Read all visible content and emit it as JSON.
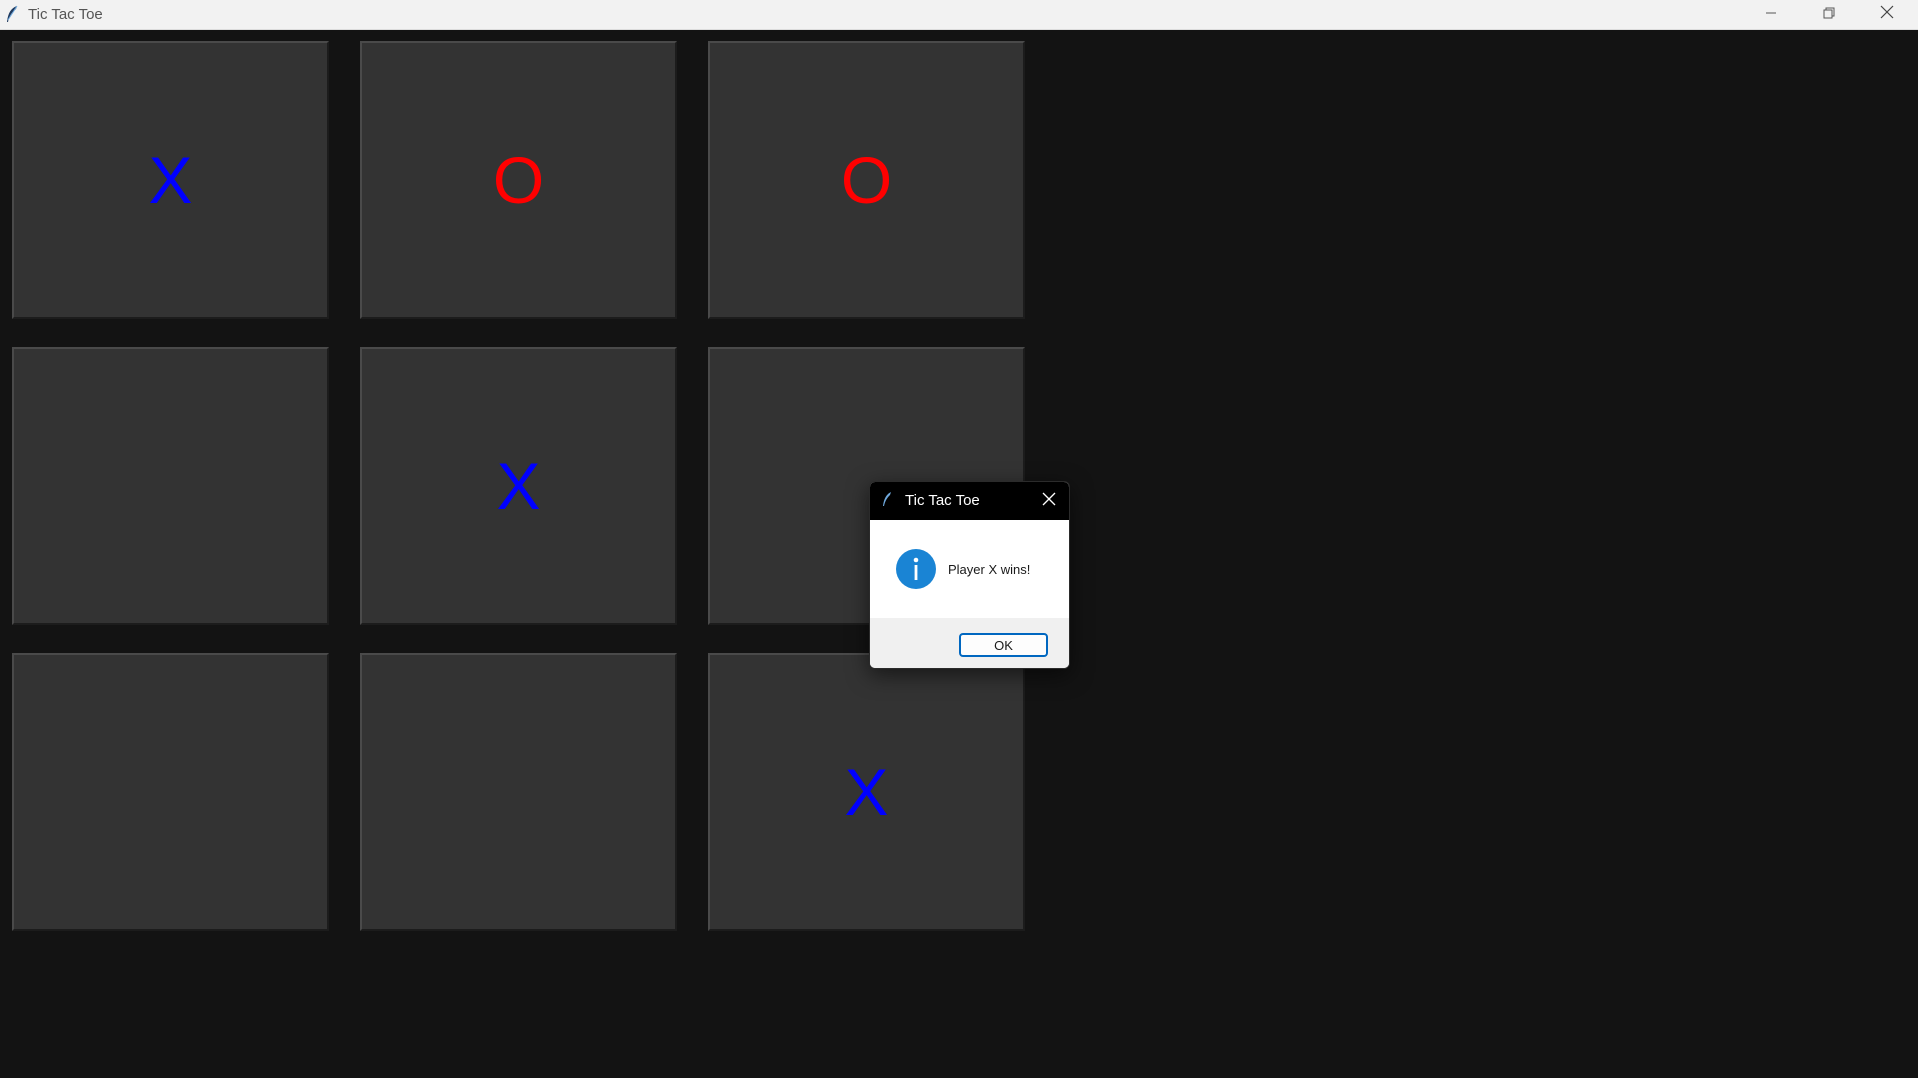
{
  "window": {
    "title": "Tic Tac Toe",
    "app_icon": "feather-icon"
  },
  "window_controls": {
    "minimize_icon": "minimize-icon",
    "maximize_icon": "restore-icon",
    "close_icon": "close-icon"
  },
  "board": {
    "cells": [
      {
        "mark": "X",
        "color": "#0000ff"
      },
      {
        "mark": "O",
        "color": "#ff0000"
      },
      {
        "mark": "O",
        "color": "#ff0000"
      },
      {
        "mark": "",
        "color": "#0000ff"
      },
      {
        "mark": "X",
        "color": "#0000ff"
      },
      {
        "mark": "",
        "color": "#0000ff"
      },
      {
        "mark": "",
        "color": "#0000ff"
      },
      {
        "mark": "",
        "color": "#0000ff"
      },
      {
        "mark": "X",
        "color": "#0000ff"
      }
    ],
    "cell_color": "#333333",
    "background_color": "#131313"
  },
  "dialog": {
    "title": "Tic Tac Toe",
    "icon": "info-icon",
    "message": "Player X wins!",
    "ok_label": "OK",
    "accent_color": "#0067c0"
  }
}
